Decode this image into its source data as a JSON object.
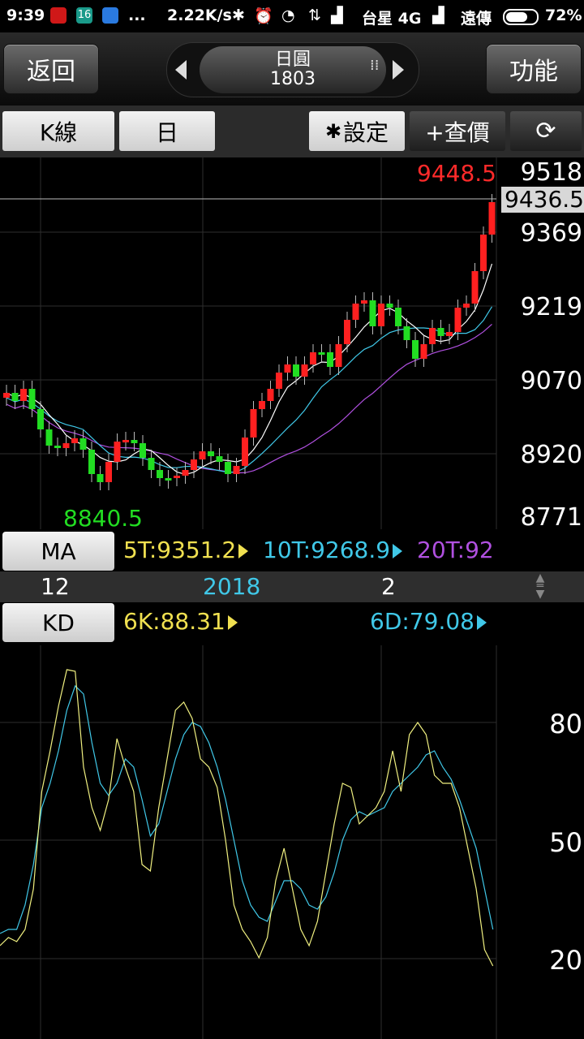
{
  "status_bar": {
    "time": "9:39",
    "notif_badge": "16",
    "more": "...",
    "net_speed": "2.22K/s",
    "carrier1": "台星 4G",
    "carrier2": "遠傳",
    "battery": "72%"
  },
  "nav": {
    "back_label": "返回",
    "title_line1": "日圓",
    "title_line2": "1803",
    "function_label": "功能"
  },
  "toolbar": {
    "kline_label": "K線",
    "period_label": "日",
    "settings_label": "設定",
    "quote_label": "+查價"
  },
  "price_chart": {
    "high_label": "9448.5",
    "low_label": "8840.5",
    "current_price": "9436.5",
    "axis_ticks": [
      "9518",
      "9369",
      "9219",
      "9070",
      "8920",
      "8771"
    ],
    "colors": {
      "up": "#ff2020",
      "down": "#22dd22",
      "ma5": "#ffffff",
      "ma10": "#40c8e8",
      "ma20": "#b050e0"
    }
  },
  "ma_row": {
    "label": "MA",
    "ma5": "5T:9351.2",
    "ma10": "10T:9268.9",
    "ma20": "20T:92"
  },
  "date_axis": [
    "12",
    "2018",
    "2"
  ],
  "kd_row": {
    "label": "KD",
    "k_value": "6K:88.31",
    "d_value": "6D:79.08",
    "axis_ticks": [
      "80",
      "50",
      "20"
    ],
    "colors": {
      "k": "#f0f080",
      "d": "#40c8e8"
    }
  }
}
